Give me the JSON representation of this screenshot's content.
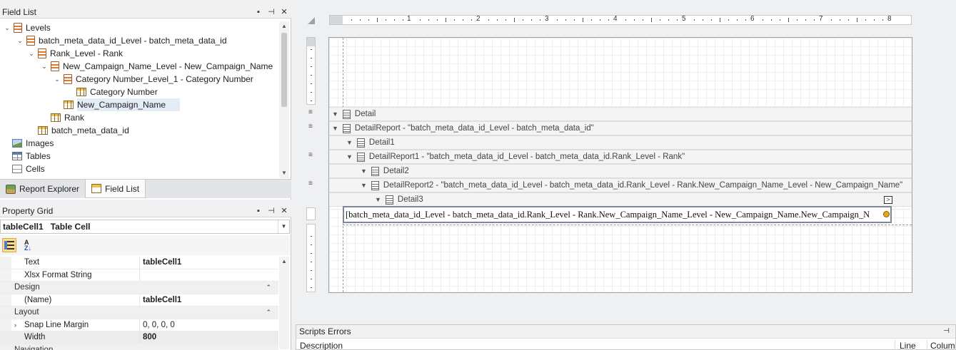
{
  "field_list": {
    "title": "Field List",
    "buttons": {
      "minimize": "▪",
      "pin": "⊣",
      "close": "✕"
    },
    "tree": [
      {
        "label": "Levels",
        "icon": "level-icon",
        "expanded": true
      },
      {
        "label": "batch_meta_data_id_Level - batch_meta_data_id",
        "icon": "level-icon",
        "expanded": true
      },
      {
        "label": "Rank_Level - Rank",
        "icon": "level-icon",
        "expanded": true
      },
      {
        "label": "New_Campaign_Name_Level - New_Campaign_Name",
        "icon": "level-icon",
        "expanded": true
      },
      {
        "label": "Category Number_Level_1 - Category Number",
        "icon": "level-icon",
        "expanded": true
      },
      {
        "label": "Category Number",
        "icon": "field-icon"
      },
      {
        "label": "New_Campaign_Name",
        "icon": "field-icon",
        "selected": true
      },
      {
        "label": "Rank",
        "icon": "field-icon"
      },
      {
        "label": "batch_meta_data_id",
        "icon": "field-icon"
      },
      {
        "label": "Images",
        "icon": "images-icon"
      },
      {
        "label": "Tables",
        "icon": "tables-icon"
      },
      {
        "label": "Cells",
        "icon": "cells-icon"
      }
    ],
    "tabs": [
      {
        "label": "Report Explorer",
        "active": false
      },
      {
        "label": "Field List",
        "active": true
      }
    ]
  },
  "property_grid": {
    "title": "Property Grid",
    "object": "tableCell1   Table Cell",
    "rows": [
      {
        "type": "prop",
        "name": "Text",
        "value": "tableCell1",
        "bold": true
      },
      {
        "type": "prop",
        "name": "Xlsx Format String",
        "value": ""
      },
      {
        "type": "cat",
        "name": "Design"
      },
      {
        "type": "prop",
        "name": "(Name)",
        "value": "tableCell1",
        "bold": true
      },
      {
        "type": "cat",
        "name": "Layout"
      },
      {
        "type": "prop",
        "name": "Snap Line Margin",
        "value": "0, 0, 0, 0",
        "expandable": true
      },
      {
        "type": "prop",
        "name": "Width",
        "value": "800",
        "bold": true,
        "selected": true
      },
      {
        "type": "cat",
        "name": "Navigation"
      }
    ]
  },
  "designer": {
    "ruler_numbers": [
      "1",
      "2",
      "3",
      "4",
      "5",
      "6",
      "7",
      "8"
    ],
    "bands": [
      {
        "label": "Detail"
      },
      {
        "label": "DetailReport - \"batch_meta_data_id_Level - batch_meta_data_id\""
      },
      {
        "label": "Detail1"
      },
      {
        "label": "DetailReport1 - \"batch_meta_data_id_Level - batch_meta_data_id.Rank_Level - Rank\""
      },
      {
        "label": "Detail2"
      },
      {
        "label": "DetailReport2 - \"batch_meta_data_id_Level - batch_meta_data_id.Rank_Level - Rank.New_Campaign_Name_Level - New_Campaign_Name\""
      },
      {
        "label": "Detail3"
      }
    ],
    "smart_tag": ">",
    "cell_text": "[batch_meta_data_id_Level - batch_meta_data_id.Rank_Level - Rank.New_Campaign_Name_Level - New_Campaign_Name.New_Campaign_N"
  },
  "scripts_errors": {
    "title": "Scripts Errors",
    "pin": "⊣",
    "columns": [
      "Description",
      "Line",
      "Column"
    ]
  }
}
